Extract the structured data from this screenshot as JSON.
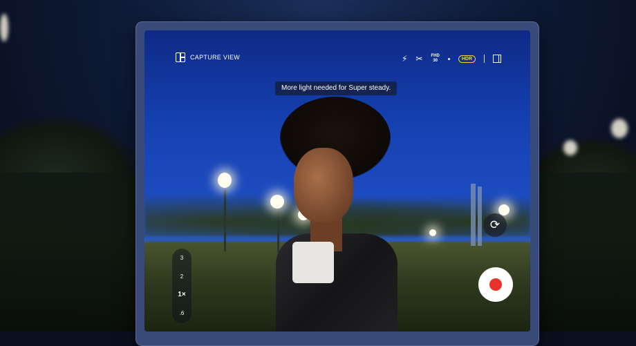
{
  "topbar": {
    "capture_view_label": "CAPTURE VIEW",
    "fhd_top": "FHD",
    "fhd_bottom": "30",
    "hdr_label": "HDR",
    "flash_icon": "⚡",
    "motion_icon": "✂"
  },
  "toast": {
    "message": "More light needed for Super steady."
  },
  "zoom": {
    "levels": [
      "3",
      "2",
      "1×",
      ".6"
    ],
    "selected": "1×"
  },
  "icons": {
    "flip": "⟳"
  },
  "colors": {
    "record_red": "#e8322b",
    "hdr_yellow": "#f5d24a"
  }
}
